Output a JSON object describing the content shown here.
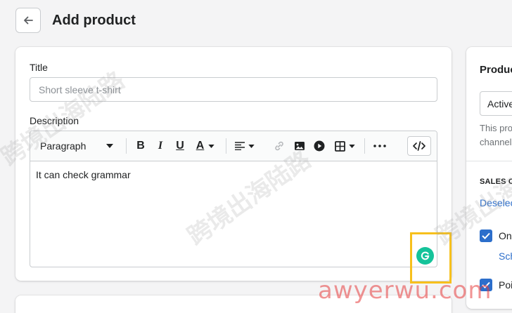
{
  "header": {
    "title": "Add product"
  },
  "form": {
    "title_label": "Title",
    "title_placeholder": "Short sleeve t-shirt",
    "description_label": "Description",
    "toolbar": {
      "paragraph_label": "Paragraph",
      "bold": "B",
      "italic": "I",
      "underline": "U",
      "text_color": "A"
    },
    "editor_text": "It can check grammar"
  },
  "sidebar": {
    "title": "Product status",
    "status_value": "Active",
    "help_line1": "This product will be",
    "help_line2": "channels",
    "section_label": "SALES CHANNELS AND APPS",
    "deselect_label": "Deselect all",
    "channel1": "Online Store",
    "channel1_link": "Schedule availability",
    "channel2": "Point of Sale"
  },
  "watermarks": {
    "text": "跨境出海陆路",
    "site": "awyerwu.com"
  },
  "colors": {
    "accent": "#2c6ecb",
    "grammarly": "#15c39a",
    "highlight": "#f7c01c"
  }
}
